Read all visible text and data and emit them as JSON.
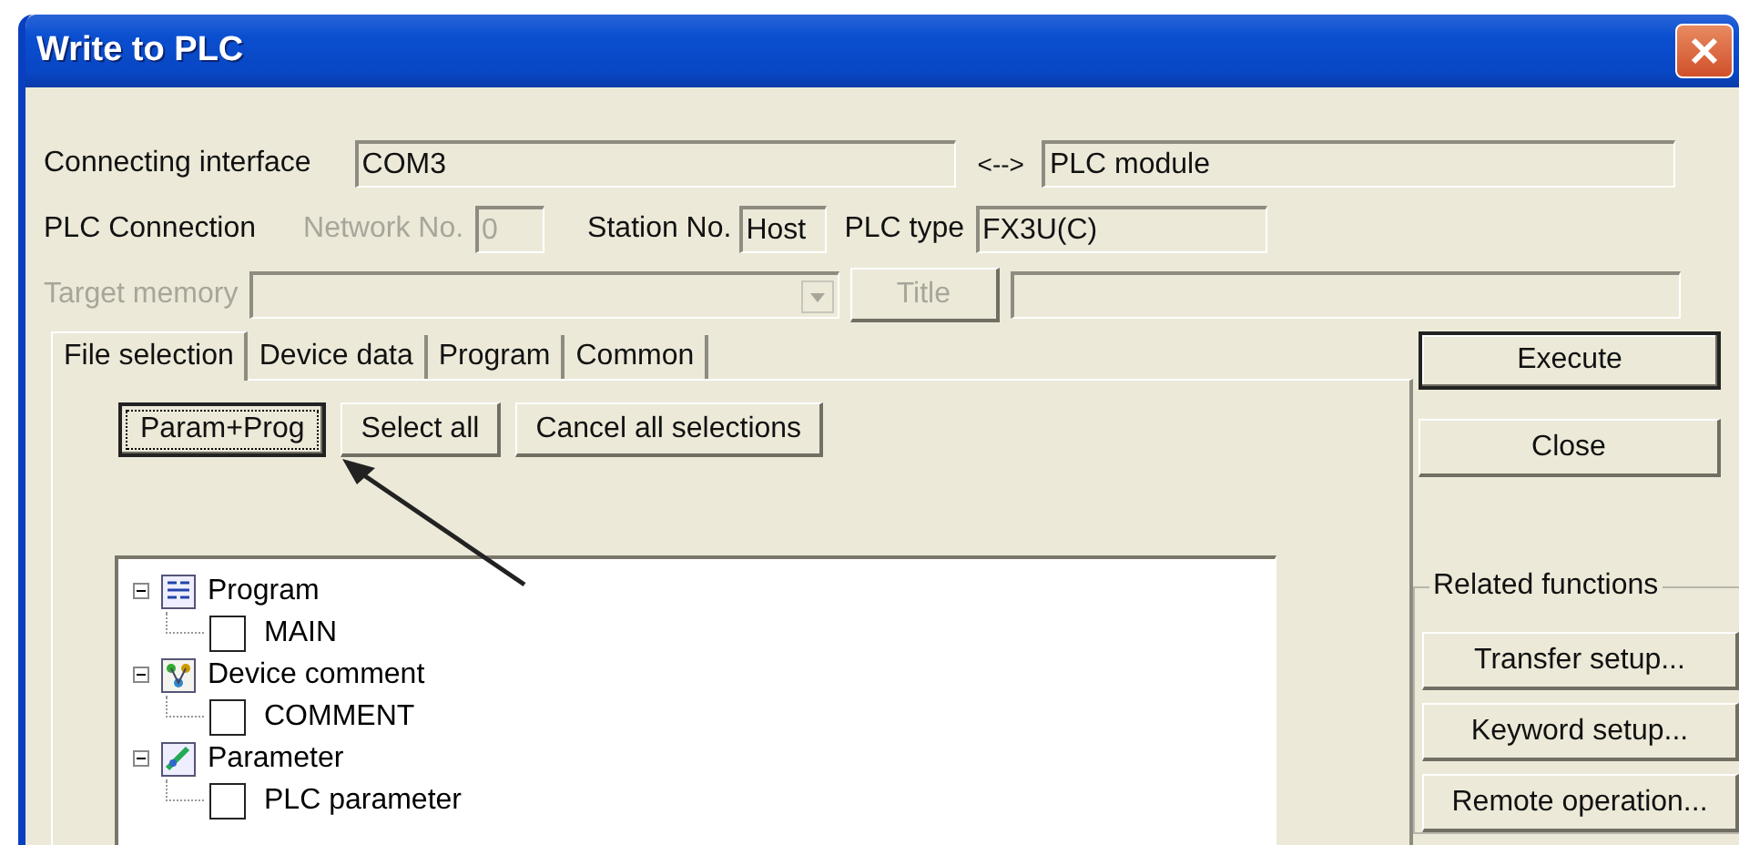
{
  "window": {
    "title": "Write to PLC"
  },
  "connection": {
    "interface_label": "Connecting interface",
    "interface_value": "COM3",
    "link_symbol": "<-->",
    "target_value": "PLC module",
    "plc_connection_label": "PLC Connection",
    "network_label": "Network No.",
    "network_value": "0",
    "network_disabled": true,
    "station_label": "Station No.",
    "station_value": "Host",
    "plc_type_label": "PLC type",
    "plc_type_value": "FX3U(C)"
  },
  "target_memory": {
    "label": "Target memory",
    "disabled": true,
    "title_button": "Title"
  },
  "tabs": [
    {
      "label": "File selection",
      "selected": true
    },
    {
      "label": "Device data",
      "selected": false
    },
    {
      "label": "Program",
      "selected": false
    },
    {
      "label": "Common",
      "selected": false
    }
  ],
  "file_buttons": [
    {
      "label": "Param+Prog",
      "focused": true
    },
    {
      "label": "Select all",
      "focused": false
    },
    {
      "label": "Cancel all selections",
      "focused": false
    }
  ],
  "tree": {
    "items": [
      {
        "label": "Program",
        "kind": "program",
        "expanded": true,
        "children": [
          {
            "label": "MAIN",
            "checked": false
          }
        ]
      },
      {
        "label": "Device comment",
        "kind": "comment",
        "expanded": true,
        "children": [
          {
            "label": "COMMENT",
            "checked": false
          }
        ]
      },
      {
        "label": "Parameter",
        "kind": "parameter",
        "expanded": true,
        "children": [
          {
            "label": "PLC parameter",
            "checked": false
          }
        ]
      }
    ]
  },
  "actions": [
    {
      "label": "Execute",
      "default": true
    },
    {
      "label": "Close",
      "default": false
    }
  ],
  "related_functions": {
    "title": "Related functions",
    "buttons": [
      "Transfer setup...",
      "Keyword setup...",
      "Remote operation..."
    ]
  }
}
